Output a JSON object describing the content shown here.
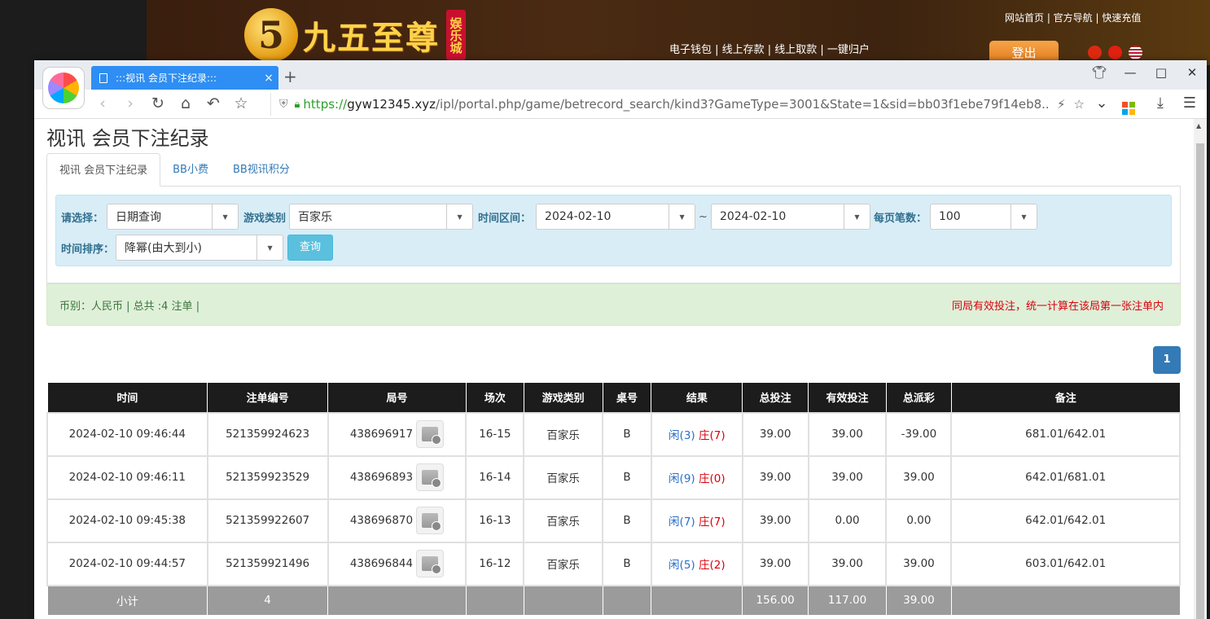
{
  "site": {
    "logo_digit": "5",
    "logo_text": "九五至尊",
    "logo_tag": "娱乐城",
    "top_links": "网站首页 | 官方导航 | 快速充值",
    "mid_links": "电子钱包 | 线上存款 | 线上取款 | 一键归户",
    "logout": "登出"
  },
  "browser": {
    "tab_title": ":::视讯 会员下注纪录:::",
    "tab_close": "×",
    "new_tab": "+",
    "url_scheme": "https://",
    "url_host": "gyw12345.xyz",
    "url_path": "/ipl/portal.php/game/betrecord_search/kind3?GameType=3001&State=1&sid=bb03f1ebe79f14eb8..."
  },
  "page": {
    "title": "视讯 会员下注纪录",
    "tabs": [
      "视讯 会员下注纪录",
      "BB小费",
      "BB视讯积分"
    ],
    "filter": {
      "select_label": "请选择：",
      "select_value": "日期查询",
      "game_label": "游戏类别",
      "game_value": "百家乐",
      "range_label": "时间区间：",
      "date_from": "2024-02-10",
      "range_sep": "~",
      "date_to": "2024-02-10",
      "per_page_label": "每页笔数：",
      "per_page_value": "100",
      "sort_label": "时间排序：",
      "sort_value": "降幂(由大到小)",
      "query_button": "查询"
    },
    "info_left": "币别：人民币 | 总共 :4 注单 |",
    "info_right": "同局有效投注，统一计算在该局第一张注单内",
    "page_number": "1"
  },
  "table": {
    "headers": [
      "时间",
      "注单编号",
      "局号",
      "场次",
      "游戏类别",
      "桌号",
      "结果",
      "总投注",
      "有效投注",
      "总派彩",
      "备注"
    ],
    "rows": [
      {
        "time": "2024-02-10 09:46:44",
        "bet_id": "521359924623",
        "round": "438696917",
        "session": "16-15",
        "game": "百家乐",
        "table": "B",
        "res_player": "闲(3)",
        "res_banker": "庄(7)",
        "total_bet": "39.00",
        "valid_bet": "39.00",
        "payout": "-39.00",
        "note": "681.01/642.01"
      },
      {
        "time": "2024-02-10 09:46:11",
        "bet_id": "521359923529",
        "round": "438696893",
        "session": "16-14",
        "game": "百家乐",
        "table": "B",
        "res_player": "闲(9)",
        "res_banker": "庄(0)",
        "total_bet": "39.00",
        "valid_bet": "39.00",
        "payout": "39.00",
        "note": "642.01/681.01"
      },
      {
        "time": "2024-02-10 09:45:38",
        "bet_id": "521359922607",
        "round": "438696870",
        "session": "16-13",
        "game": "百家乐",
        "table": "B",
        "res_player": "闲(7)",
        "res_banker": "庄(7)",
        "total_bet": "39.00",
        "valid_bet": "0.00",
        "payout": "0.00",
        "note": "642.01/642.01"
      },
      {
        "time": "2024-02-10 09:44:57",
        "bet_id": "521359921496",
        "round": "438696844",
        "session": "16-12",
        "game": "百家乐",
        "table": "B",
        "res_player": "闲(5)",
        "res_banker": "庄(2)",
        "total_bet": "39.00",
        "valid_bet": "39.00",
        "payout": "39.00",
        "note": "603.01/642.01"
      }
    ],
    "subtotal": {
      "label": "小计",
      "count": "4",
      "total_bet": "156.00",
      "valid_bet": "117.00",
      "payout": "39.00"
    }
  },
  "colors": {
    "accent": "#2e8ef3",
    "header_bg": "#1c1c1c",
    "negative": "#d9000d",
    "link_blue": "#2a6ec8"
  }
}
